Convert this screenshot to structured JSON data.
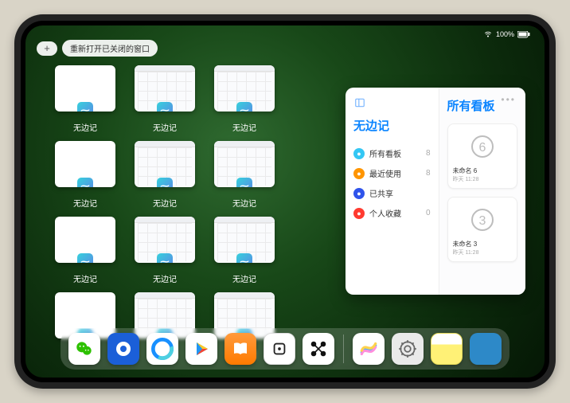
{
  "status": {
    "time": "",
    "battery": "100%"
  },
  "topbar": {
    "plus": "+",
    "reopen_label": "重新打开已关闭的窗口"
  },
  "app_name": "无边记",
  "windows": [
    {
      "type": "blank"
    },
    {
      "type": "grid"
    },
    {
      "type": "grid"
    },
    null,
    {
      "type": "blank"
    },
    {
      "type": "grid"
    },
    {
      "type": "grid"
    },
    null,
    {
      "type": "blank"
    },
    {
      "type": "grid"
    },
    {
      "type": "grid"
    },
    null,
    {
      "type": "blank"
    },
    {
      "type": "grid"
    },
    {
      "type": "grid"
    }
  ],
  "popover": {
    "left_title": "无边记",
    "right_title": "所有看板",
    "items": [
      {
        "icon_color": "blue",
        "label": "所有看板",
        "count": "8"
      },
      {
        "icon_color": "orange",
        "label": "最近使用",
        "count": "8"
      },
      {
        "icon_color": "navy",
        "label": "已共享",
        "count": ""
      },
      {
        "icon_color": "red",
        "label": "个人收藏",
        "count": "0"
      }
    ],
    "ellipsis": "•••",
    "cards": [
      {
        "num": "6",
        "title": "未命名 6",
        "sub": "昨天 11:28"
      },
      {
        "num": "3",
        "title": "未命名 3",
        "sub": "昨天 11:28"
      }
    ]
  },
  "dock": {
    "icons": [
      "wechat",
      "qq-blue",
      "browser-circle",
      "play",
      "books",
      "dice",
      "connect-dots"
    ],
    "recent": [
      "freeform",
      "settings",
      "notes",
      "app-folder"
    ]
  }
}
